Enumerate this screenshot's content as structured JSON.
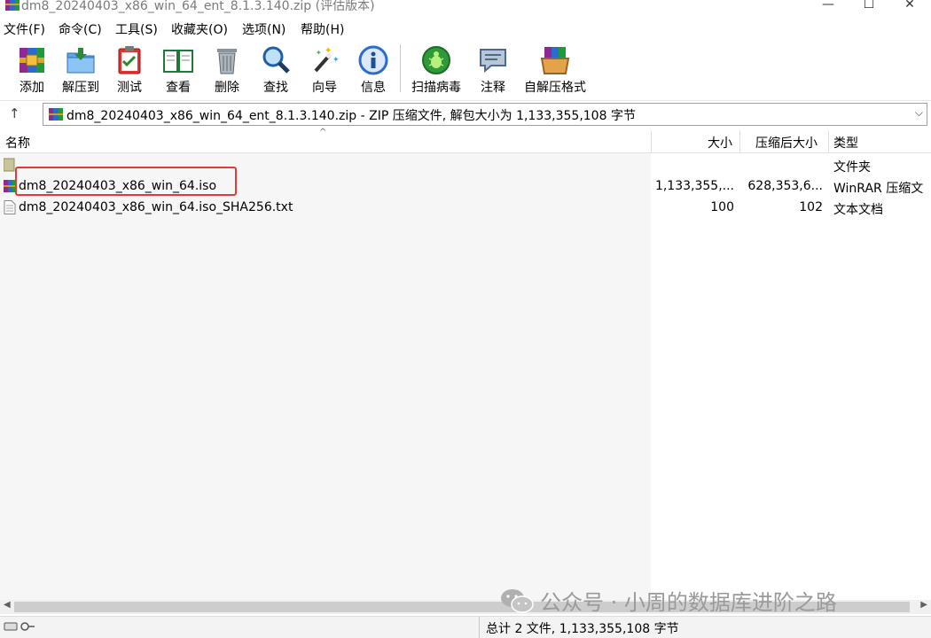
{
  "window": {
    "title": "dm8_20240403_x86_win_64_ent_8.1.3.140.zip (评估版本)",
    "minimize": "—",
    "maximize": "☐",
    "close": "✕"
  },
  "menu": [
    "文件(F)",
    "命令(C)",
    "工具(S)",
    "收藏夹(O)",
    "选项(N)",
    "帮助(H)"
  ],
  "toolbar": {
    "add": "添加",
    "extract_to": "解压到",
    "test": "测试",
    "view": "查看",
    "delete": "删除",
    "find": "查找",
    "wizard": "向导",
    "info": "信息",
    "virus_scan": "扫描病毒",
    "comment": "注释",
    "sfx": "自解压格式"
  },
  "address": {
    "up_icon": "↑",
    "path": "dm8_20240403_x86_win_64_ent_8.1.3.140.zip - ZIP 压缩文件, 解包大小为 1,133,355,108 字节",
    "dropdown_icon": "⌵"
  },
  "columns": {
    "name": "名称",
    "size": "大小",
    "packed": "压缩后大小",
    "type": "类型"
  },
  "rows": [
    {
      "name": "",
      "size": "",
      "packed": "",
      "type": "文件夹",
      "icon": "folder-up-icon"
    },
    {
      "name": "dm8_20240403_x86_win_64.iso",
      "size": "1,133,355,...",
      "packed": "628,353,6...",
      "type": "WinRAR 压缩文",
      "icon": "winrar-archive-icon"
    },
    {
      "name": "dm8_20240403_x86_win_64.iso_SHA256.txt",
      "size": "100",
      "packed": "102",
      "type": "文本文档",
      "icon": "text-file-icon"
    }
  ],
  "status": {
    "summary": "总计 2 文件, 1,133,355,108 字节"
  },
  "watermark": {
    "text": "公众号 · 小周的数据库进阶之路"
  },
  "colors": {
    "highlight": "#e53935",
    "title_text": "#7a7a7a"
  }
}
